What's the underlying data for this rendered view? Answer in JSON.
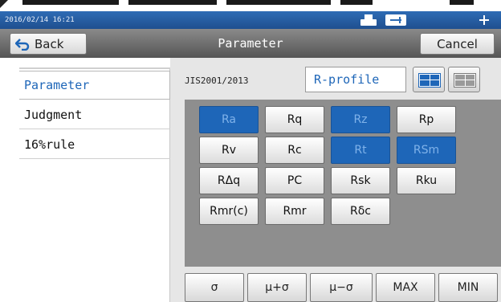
{
  "statusbar": {
    "timestamp": "2016/02/14 16:21",
    "icons": [
      "printer-icon",
      "usb-icon",
      "move-icon"
    ]
  },
  "titlebar": {
    "title": "Parameter",
    "back_label": "Back",
    "cancel_label": "Cancel"
  },
  "sidebar": {
    "items": [
      {
        "label": "Parameter",
        "active": true
      },
      {
        "label": "Judgment",
        "active": false
      },
      {
        "label": "16%rule",
        "active": false
      }
    ]
  },
  "main": {
    "standard": "JIS2001/2013",
    "profile": "R-profile",
    "view_icons": [
      "grid-view-selected-icon",
      "grid-view-icon"
    ],
    "parameters": [
      {
        "label": "Ra",
        "selected": true
      },
      {
        "label": "Rq",
        "selected": false
      },
      {
        "label": "Rz",
        "selected": true
      },
      {
        "label": "Rp",
        "selected": false
      },
      {
        "label": "Rv",
        "selected": false
      },
      {
        "label": "Rc",
        "selected": false
      },
      {
        "label": "Rt",
        "selected": true
      },
      {
        "label": "RSm",
        "selected": true
      },
      {
        "label": "RΔq",
        "selected": false
      },
      {
        "label": "PC",
        "selected": false
      },
      {
        "label": "Rsk",
        "selected": false
      },
      {
        "label": "Rku",
        "selected": false
      },
      {
        "label": "Rmr(c)",
        "selected": false
      },
      {
        "label": "Rmr",
        "selected": false
      },
      {
        "label": "Rδc",
        "selected": false
      }
    ],
    "bottom_buttons": [
      "σ",
      "μ+σ",
      "μ−σ",
      "MAX",
      "MIN"
    ]
  },
  "colors": {
    "accent": "#1e66b8",
    "statusbar": "#2a5fa3",
    "titlebar": "#6e6e6e",
    "panel": "#8e8e8e"
  }
}
